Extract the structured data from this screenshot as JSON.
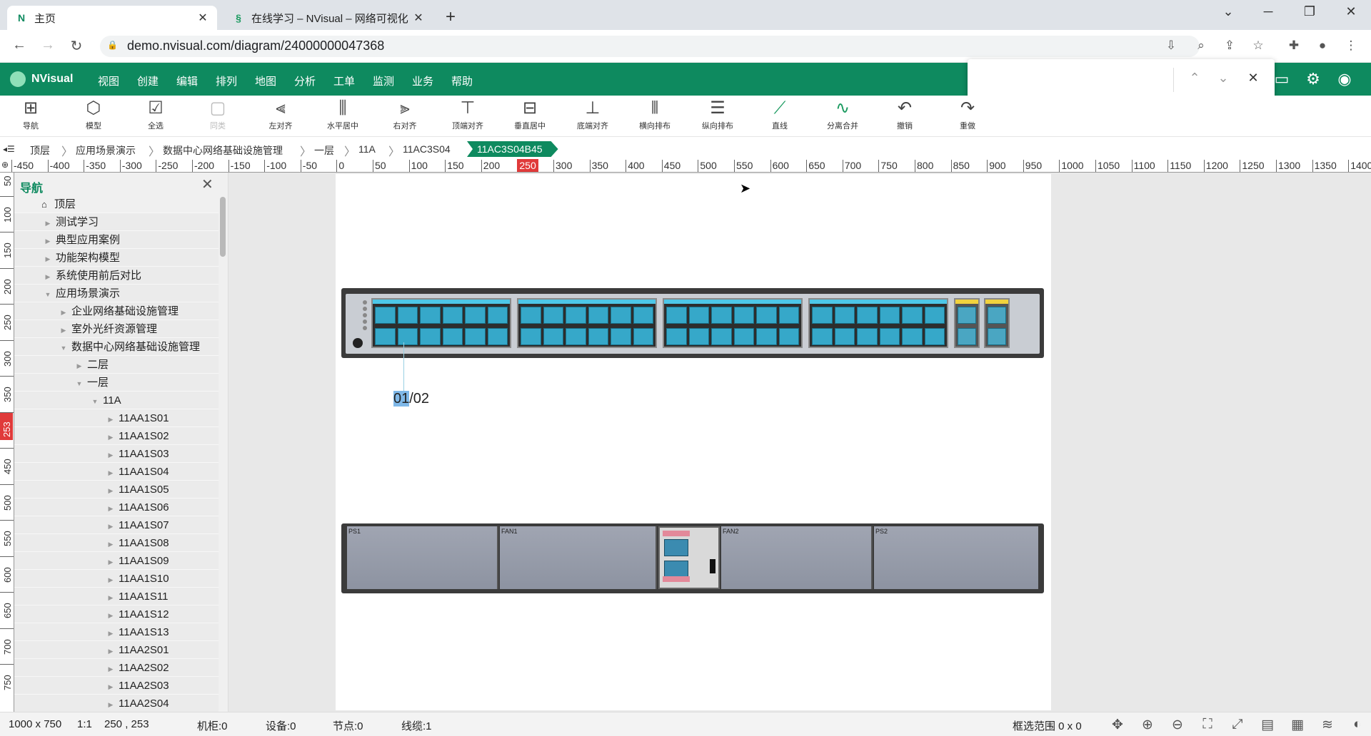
{
  "browser": {
    "tabs": [
      {
        "favicon": "N",
        "title": "主页",
        "active": true
      },
      {
        "favicon": "§",
        "title": "在线学习 – NVisual – 网络可视化",
        "active": false
      }
    ],
    "url": "demo.nvisual.com/diagram/24000000047368"
  },
  "app": {
    "name": "NVisual",
    "menu": [
      "视图",
      "创建",
      "编辑",
      "排列",
      "地图",
      "分析",
      "工单",
      "监测",
      "业务",
      "帮助"
    ]
  },
  "find": {
    "value": "",
    "placeholder": ""
  },
  "toolbar": [
    {
      "label": "导航",
      "icon": "navigation-icon",
      "glyph": "⊞",
      "state": "normal"
    },
    {
      "label": "模型",
      "icon": "cube-icon",
      "glyph": "⬡",
      "state": "normal"
    },
    {
      "label": "全选",
      "icon": "select-all-icon",
      "glyph": "☑",
      "state": "normal"
    },
    {
      "label": "同类",
      "icon": "same-type-icon",
      "glyph": "▢",
      "state": "disabled"
    },
    {
      "label": "左对齐",
      "icon": "align-left-icon",
      "glyph": "⫷",
      "state": "normal"
    },
    {
      "label": "水平居中",
      "icon": "align-hcenter-icon",
      "glyph": "⫼",
      "state": "normal"
    },
    {
      "label": "右对齐",
      "icon": "align-right-icon",
      "glyph": "⫸",
      "state": "normal"
    },
    {
      "label": "顶端对齐",
      "icon": "align-top-icon",
      "glyph": "⊤",
      "state": "normal"
    },
    {
      "label": "垂直居中",
      "icon": "align-vcenter-icon",
      "glyph": "⊟",
      "state": "normal"
    },
    {
      "label": "底端对齐",
      "icon": "align-bottom-icon",
      "glyph": "⊥",
      "state": "normal"
    },
    {
      "label": "横向排布",
      "icon": "distribute-horizontal-icon",
      "glyph": "⫴",
      "state": "normal"
    },
    {
      "label": "纵向排布",
      "icon": "distribute-vertical-icon",
      "glyph": "☰",
      "state": "normal"
    },
    {
      "label": "直线",
      "icon": "line-icon",
      "glyph": "⟋",
      "state": "green"
    },
    {
      "label": "分离合并",
      "icon": "split-merge-icon",
      "glyph": "∿",
      "state": "green"
    },
    {
      "label": "撤销",
      "icon": "undo-icon",
      "glyph": "↶",
      "state": "normal"
    },
    {
      "label": "重做",
      "icon": "redo-icon",
      "glyph": "↷",
      "state": "normal"
    }
  ],
  "breadcrumb": [
    "顶层",
    "应用场景演示",
    "数据中心网络基础设施管理",
    "一层",
    "11A",
    "11AC3S04"
  ],
  "breadcrumb_active": "11AC3S04B45",
  "hruler": {
    "ticks": [
      "-450",
      "-400",
      "-350",
      "-300",
      "-250",
      "-200",
      "-150",
      "-100",
      "-50",
      "0",
      "50",
      "100",
      "150",
      "200",
      "250",
      "300",
      "350",
      "400",
      "450",
      "500",
      "550",
      "600",
      "650",
      "700",
      "750",
      "800",
      "850",
      "900",
      "950",
      "1000",
      "1050",
      "1100",
      "1150",
      "1200",
      "1250",
      "1300",
      "1350",
      "1400"
    ],
    "marker": "250"
  },
  "vruler": {
    "ticks": [
      "50",
      "100",
      "150",
      "200",
      "250",
      "300",
      "350",
      "400",
      "450",
      "500",
      "550",
      "600",
      "650",
      "700",
      "750"
    ],
    "marker": "253"
  },
  "nav": {
    "title": "导航",
    "tree": [
      {
        "label": "顶层",
        "level": 0,
        "expand": "home"
      },
      {
        "label": "测试学习",
        "level": 1,
        "expand": "closed"
      },
      {
        "label": "典型应用案例",
        "level": 1,
        "expand": "closed"
      },
      {
        "label": "功能架构模型",
        "level": 1,
        "expand": "closed"
      },
      {
        "label": "系统使用前后对比",
        "level": 1,
        "expand": "closed"
      },
      {
        "label": "应用场景演示",
        "level": 1,
        "expand": "open"
      },
      {
        "label": "企业网络基础设施管理",
        "level": 2,
        "expand": "closed"
      },
      {
        "label": "室外光纤资源管理",
        "level": 2,
        "expand": "closed"
      },
      {
        "label": "数据中心网络基础设施管理",
        "level": 2,
        "expand": "open"
      },
      {
        "label": "二层",
        "level": 3,
        "expand": "closed"
      },
      {
        "label": "一层",
        "level": 3,
        "expand": "open"
      },
      {
        "label": "11A",
        "level": 4,
        "expand": "open"
      },
      {
        "label": "11AA1S01",
        "level": 5,
        "expand": "closed"
      },
      {
        "label": "11AA1S02",
        "level": 5,
        "expand": "closed"
      },
      {
        "label": "11AA1S03",
        "level": 5,
        "expand": "closed"
      },
      {
        "label": "11AA1S04",
        "level": 5,
        "expand": "closed"
      },
      {
        "label": "11AA1S05",
        "level": 5,
        "expand": "closed"
      },
      {
        "label": "11AA1S06",
        "level": 5,
        "expand": "closed"
      },
      {
        "label": "11AA1S07",
        "level": 5,
        "expand": "closed"
      },
      {
        "label": "11AA1S08",
        "level": 5,
        "expand": "closed"
      },
      {
        "label": "11AA1S09",
        "level": 5,
        "expand": "closed"
      },
      {
        "label": "11AA1S10",
        "level": 5,
        "expand": "closed"
      },
      {
        "label": "11AA1S11",
        "level": 5,
        "expand": "closed"
      },
      {
        "label": "11AA1S12",
        "level": 5,
        "expand": "closed"
      },
      {
        "label": "11AA1S13",
        "level": 5,
        "expand": "closed"
      },
      {
        "label": "11AA2S01",
        "level": 5,
        "expand": "closed"
      },
      {
        "label": "11AA2S02",
        "level": 5,
        "expand": "closed"
      },
      {
        "label": "11AA2S03",
        "level": 5,
        "expand": "closed"
      },
      {
        "label": "11AA2S04",
        "level": 5,
        "expand": "closed"
      }
    ]
  },
  "canvas": {
    "port_label_highlight": "01",
    "port_label_rest": "/02",
    "rear_bays": [
      "PS1",
      "FAN1",
      "FAN2",
      "PS2"
    ]
  },
  "status": {
    "canvas_size": "1000 x 750",
    "zoom": "1:1",
    "cursor_pos": "250 , 253",
    "racks": "机柜:0",
    "devices": "设备:0",
    "nodes": "节点:0",
    "lines": "线缆:1",
    "selection": "框选范围 0 x 0"
  },
  "colors": {
    "brand": "#0e8a5f",
    "ruler_marker": "#e03a3a",
    "port": "#36a8c9"
  }
}
